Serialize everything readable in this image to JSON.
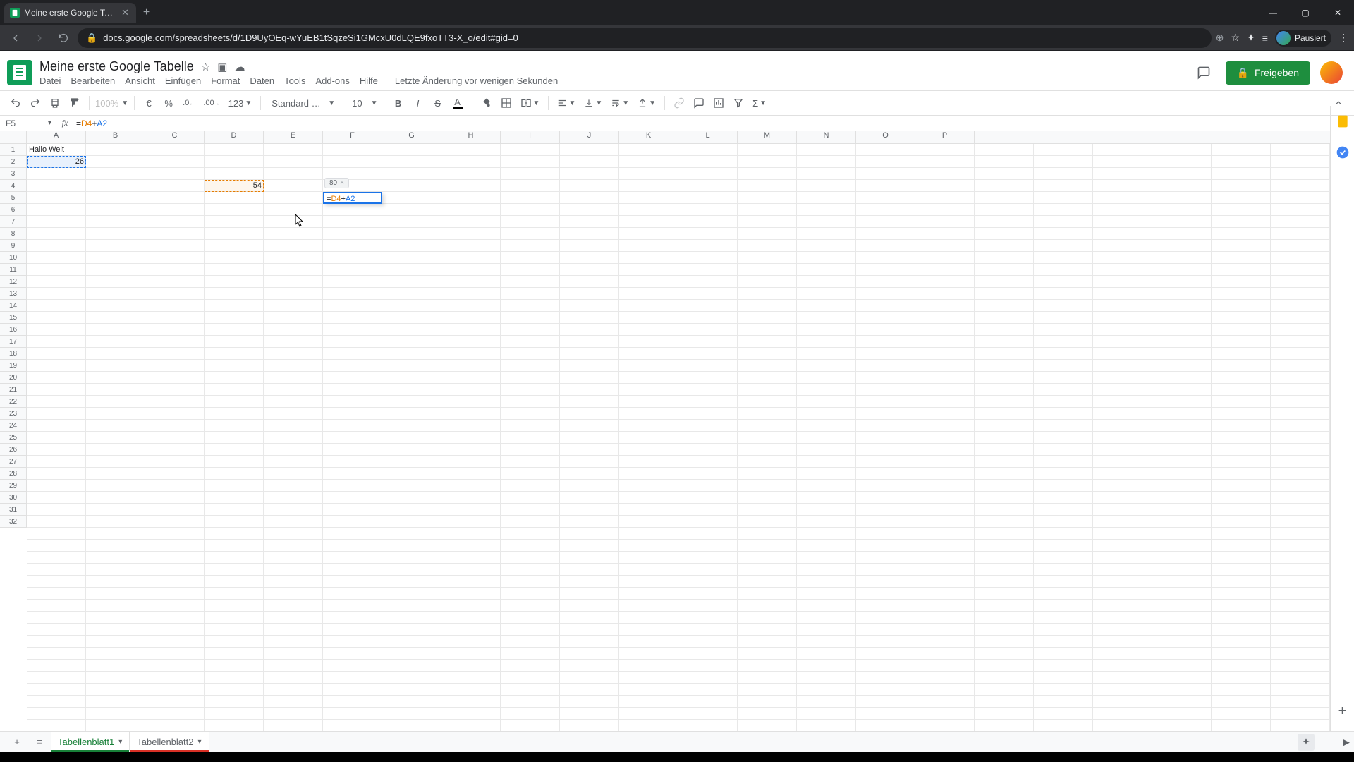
{
  "browser": {
    "tab_title": "Meine erste Google Tabelle - Go...",
    "url": "docs.google.com/spreadsheets/d/1D9UyOEq-wYuEB1tSqzeSi1GMcxU0dLQE9fxoTT3-X_o/edit#gid=0",
    "profile_status": "Pausiert"
  },
  "doc": {
    "title": "Meine erste Google Tabelle",
    "menus": {
      "file": "Datei",
      "edit": "Bearbeiten",
      "view": "Ansicht",
      "insert": "Einfügen",
      "format": "Format",
      "data": "Daten",
      "tools": "Tools",
      "addons": "Add-ons",
      "help": "Hilfe"
    },
    "last_edit": "Letzte Änderung vor wenigen Sekunden",
    "share": "Freigeben",
    "comment_tooltip": "Kommentarverlauf öffnen"
  },
  "toolbar": {
    "zoom": "100%",
    "currency": "€",
    "percent": "%",
    "dec_less": ".0",
    "dec_more": ".00",
    "numfmt": "123",
    "font": "Standard (…",
    "font_size": "10",
    "bold": "B",
    "italic": "I",
    "strike": "S",
    "textcolor": "A"
  },
  "formula_bar": {
    "name_box": "F5",
    "fx": "fx",
    "formula_prefix": "=",
    "formula_ref1": "D4",
    "formula_op": "+",
    "formula_ref2": "A2"
  },
  "grid": {
    "columns": [
      "A",
      "B",
      "C",
      "D",
      "E",
      "F",
      "G",
      "H",
      "I",
      "J",
      "K",
      "L",
      "M",
      "N",
      "O",
      "P"
    ],
    "row_count": 32,
    "cells": {
      "A1": "Hallo Welt",
      "A2": "26",
      "D4": "54"
    },
    "editing_cell": {
      "address": "F5",
      "prefix": "=",
      "ref1": "D4",
      "op": "+",
      "ref2": "A2",
      "preview": "80"
    }
  },
  "sheets": {
    "tab1": "Tabellenblatt1",
    "tab2": "Tabellenblatt2",
    "add": "+"
  }
}
